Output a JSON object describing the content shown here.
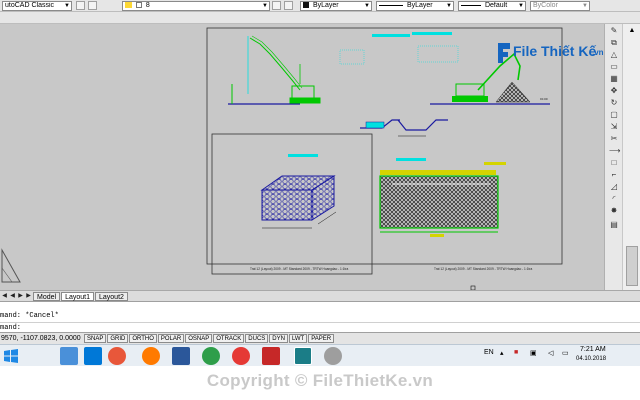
{
  "toolbar": {
    "workspace": "utoCAD Classic",
    "layer_current": "8",
    "color": "ByLayer",
    "linetype": "ByLayer",
    "lineweight": "Default",
    "plotstyle": "ByColor"
  },
  "drawing": {
    "note_left": "Trat 12 (Layout) 2009 - MT Standard 2009 - TRTW Hoangdao - 1:1tra",
    "note_right": "Trat 12 (Layout) 2009 - MT Standard 2009 - TRTW Hoangdao - 1:1tra"
  },
  "tabs": {
    "model": "Model",
    "layout1": "Layout1",
    "layout2": "Layout2"
  },
  "command": {
    "line1": "mand: *Cancel*",
    "line2": "mand:"
  },
  "status": {
    "coords": "9570, -1107.0823, 0.0000",
    "buttons": [
      "SNAP",
      "GRID",
      "ORTHO",
      "POLAR",
      "OSNAP",
      "OTRACK",
      "DUCS",
      "DYN",
      "LWT",
      "PAPER"
    ]
  },
  "taskbar": {
    "language": "EN",
    "time": "7:21 AM",
    "date": "04.10.2018"
  },
  "logo": {
    "brand": "File Thiết Kế",
    "suffix": ".vn"
  },
  "watermark": "Copyright © FileThietKe.vn",
  "colors": {
    "drawing_bg": "#c8c8c8",
    "cyan": "#00e0e0",
    "green": "#00c800",
    "yellow": "#d4d400",
    "blue": "#1a1aa0",
    "logo_blue": "#1565c0"
  }
}
